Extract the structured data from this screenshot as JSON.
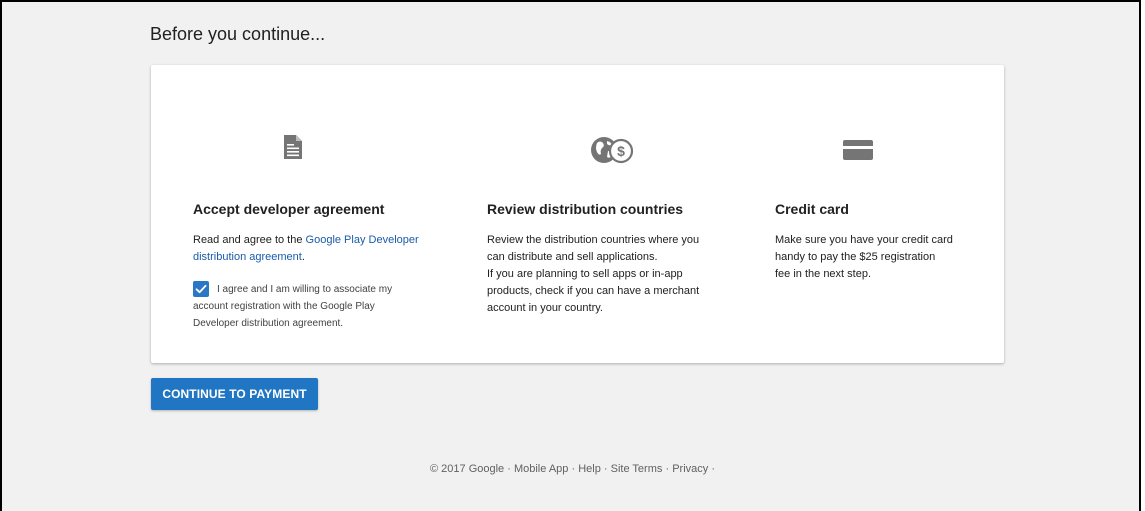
{
  "page": {
    "title": "Before you continue..."
  },
  "columns": [
    {
      "icon": "document-icon",
      "title": "Accept developer agreement",
      "text_prefix": "Read and agree to the ",
      "link_part1": "Google Play Developer",
      "link_part2": "distribution agreement",
      "text_suffix": ".",
      "agree": {
        "checked": true,
        "line1": "I agree and I am willing to associate my",
        "line2": "account registration with the Google Play",
        "line3": "Developer distribution agreement."
      }
    },
    {
      "icon": "globe-dollar-icon",
      "title": "Review distribution countries",
      "lines": [
        "Review the distribution countries where you",
        "can distribute and sell applications.",
        "If you are planning to sell apps or in-app",
        "products, check if you can have a merchant",
        "account in your country."
      ]
    },
    {
      "icon": "credit-card-icon",
      "title": "Credit card",
      "lines": [
        "Make sure you have your credit card",
        "handy to pay the $25 registration",
        "fee in the next step."
      ]
    }
  ],
  "actions": {
    "continue_label": "CONTINUE TO PAYMENT"
  },
  "footer": {
    "copyright": "© 2017 Google",
    "separator": "·",
    "links": [
      "Mobile App",
      "Help",
      "Site Terms",
      "Privacy"
    ]
  },
  "colors": {
    "primary": "#2176c3",
    "link": "#1a5ba8",
    "background": "#f1f1f1",
    "icon": "#757575"
  }
}
